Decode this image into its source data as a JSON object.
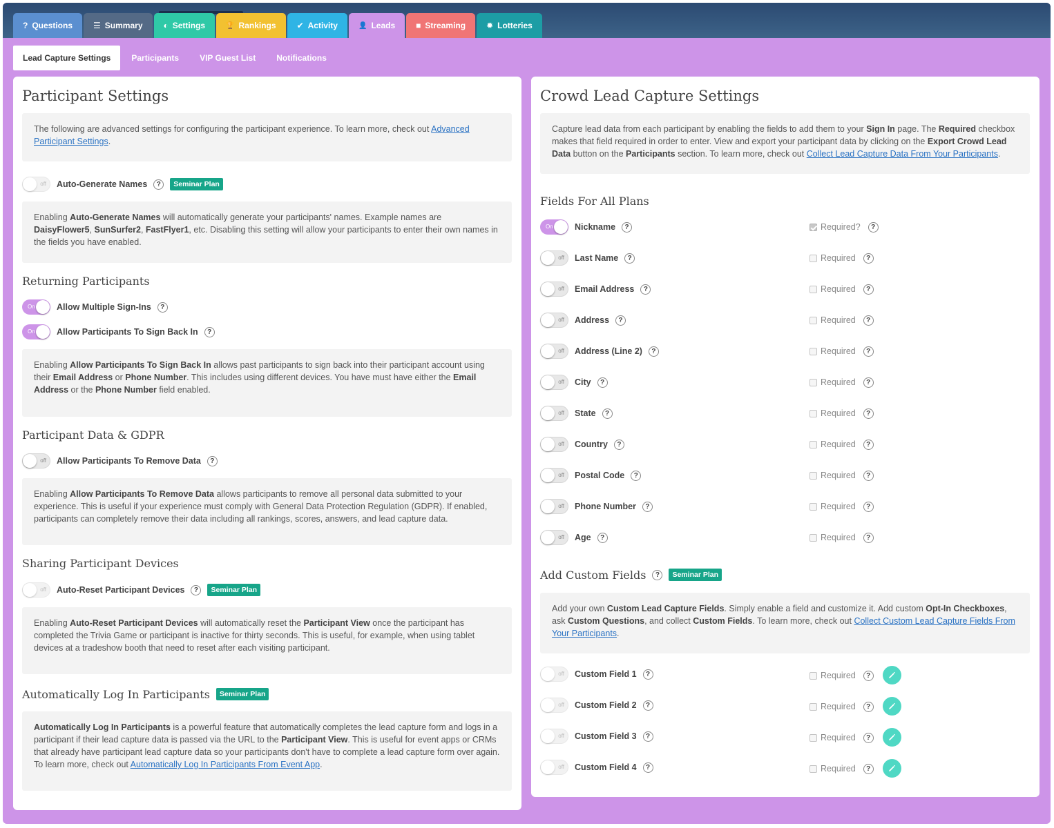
{
  "nav": {
    "tabs": [
      {
        "label": "Questions",
        "icon": "question-icon",
        "glyph": "?",
        "color": "#5b8fd0"
      },
      {
        "label": "Summary",
        "icon": "list-icon",
        "glyph": "☰",
        "color": "#546a86"
      },
      {
        "label": "Settings",
        "icon": "toggle-icon",
        "glyph": "◐",
        "color": "#2fc9a7"
      },
      {
        "label": "Rankings",
        "icon": "trophy-icon",
        "glyph": "🏆",
        "color": "#f2c131"
      },
      {
        "label": "Activity",
        "icon": "check-circle-icon",
        "glyph": "✔",
        "color": "#2fb4e5"
      },
      {
        "label": "Leads",
        "icon": "user-icon",
        "glyph": "👤",
        "color": "#cd94e8"
      },
      {
        "label": "Streaming",
        "icon": "video-icon",
        "glyph": "■",
        "color": "#f07575"
      },
      {
        "label": "Lotteries",
        "icon": "gear-icon",
        "glyph": "✹",
        "color": "#1d9da5"
      }
    ]
  },
  "subnav": {
    "tabs": [
      "Lead Capture Settings",
      "Participants",
      "VIP Guest List",
      "Notifications"
    ]
  },
  "toggle_text": {
    "on": "On",
    "off": "off"
  },
  "badge_text": "Seminar Plan",
  "help_glyph": "?",
  "left": {
    "title": "Participant Settings",
    "intro": {
      "text": "The following are advanced settings for configuring the participant experience. To learn more, check out ",
      "link": "Advanced Participant Settings",
      "end": "."
    },
    "auto_generate": {
      "label": "Auto-Generate Names",
      "desc": {
        "p1": "Enabling ",
        "b1": "Auto-Generate Names",
        "p2": " will automatically generate your participants' names. Example names are ",
        "b2": "DaisyFlower5",
        "p3": ", ",
        "b3": "SunSurfer2",
        "p4": ", ",
        "b4": "FastFlyer1",
        "p5": ", etc. Disabling this setting will allow your participants to enter their own names in the fields you have enabled."
      }
    },
    "returning": {
      "heading": "Returning Participants",
      "multiple_label": "Allow Multiple Sign-Ins",
      "signback_label": "Allow Participants To Sign Back In",
      "desc": {
        "p1": "Enabling ",
        "b1": "Allow Participants To Sign Back In",
        "p2": " allows past participants to sign back into their participant account using their ",
        "b2": "Email Address",
        "p3": " or ",
        "b3": "Phone Number",
        "p4": ". This includes using different devices. You have must have either the ",
        "b4": "Email Address",
        "p5": " or the ",
        "b5": "Phone Number",
        "p6": " field enabled."
      }
    },
    "gdpr": {
      "heading": "Participant Data & GDPR",
      "label": "Allow Participants To Remove Data",
      "desc": {
        "p1": "Enabling ",
        "b1": "Allow Participants To Remove Data",
        "p2": " allows participants to remove all personal data submitted to your experience. This is useful if your experience must comply with General Data Protection Regulation (GDPR). If enabled, participants can completely remove their data including all rankings, scores, answers, and lead capture data."
      }
    },
    "sharing": {
      "heading": "Sharing Participant Devices",
      "label": "Auto-Reset Participant Devices",
      "desc": {
        "p1": "Enabling ",
        "b1": "Auto-Reset Participant Devices",
        "p2": " will automatically reset the ",
        "b2": "Participant View",
        "p3": " once the participant has completed the Trivia Game or participant is inactive for thirty seconds. This is useful, for example, when using tablet devices at a tradeshow booth that need to reset after each visiting participant."
      }
    },
    "autologin": {
      "heading": "Automatically Log In Participants",
      "desc": {
        "b1": "Automatically Log In Participants",
        "p1": " is a powerful feature that automatically completes the lead capture form and logs in a participant if their lead capture data is passed via the URL to the ",
        "b2": "Participant View",
        "p2": ". This is useful for event apps or CRMs that already have participant lead capture data so your participants don't have to complete a lead capture form over again. To learn more, check out ",
        "link": "Automatically Log In Participants From Event App",
        "end": "."
      }
    }
  },
  "right": {
    "title": "Crowd Lead Capture Settings",
    "intro": {
      "p1": "Capture lead data from each participant by enabling the fields to add them to your ",
      "b1": "Sign In",
      "p2": " page. The ",
      "b2": "Required",
      "p3": " checkbox makes that field required in order to enter. View and export your participant data by clicking on the ",
      "b3": "Export Crowd Lead Data",
      "p4": " button on the ",
      "b4": "Participants",
      "p5": " section. To learn more, check out ",
      "link": "Collect Lead Capture Data From Your Participants",
      "end": "."
    },
    "fields_heading": "Fields For All Plans",
    "fields": [
      {
        "label": "Nickname",
        "on": true,
        "required_label": "Required?",
        "required": true
      },
      {
        "label": "Last Name",
        "on": false,
        "required_label": "Required",
        "required": false
      },
      {
        "label": "Email Address",
        "on": false,
        "required_label": "Required",
        "required": false
      },
      {
        "label": "Address",
        "on": false,
        "required_label": "Required",
        "required": false
      },
      {
        "label": "Address (Line 2)",
        "on": false,
        "required_label": "Required",
        "required": false
      },
      {
        "label": "City",
        "on": false,
        "required_label": "Required",
        "required": false
      },
      {
        "label": "State",
        "on": false,
        "required_label": "Required",
        "required": false
      },
      {
        "label": "Country",
        "on": false,
        "required_label": "Required",
        "required": false
      },
      {
        "label": "Postal Code",
        "on": false,
        "required_label": "Required",
        "required": false
      },
      {
        "label": "Phone Number",
        "on": false,
        "required_label": "Required",
        "required": false
      },
      {
        "label": "Age",
        "on": false,
        "required_label": "Required",
        "required": false
      }
    ],
    "custom_heading": "Add Custom Fields",
    "custom_intro": {
      "p1": "Add your own ",
      "b1": "Custom Lead Capture Fields",
      "p2": ". Simply enable a field and customize it. Add custom ",
      "b2": "Opt-In Checkboxes",
      "p3": ", ask ",
      "b3": "Custom Questions",
      "p4": ", and collect ",
      "b4": "Custom Fields",
      "p5": ". To learn more, check out ",
      "link": "Collect Custom Lead Capture Fields From Your Participants",
      "end": "."
    },
    "custom_fields": [
      {
        "label": "Custom Field 1",
        "required_label": "Required"
      },
      {
        "label": "Custom Field 2",
        "required_label": "Required"
      },
      {
        "label": "Custom Field 3",
        "required_label": "Required"
      },
      {
        "label": "Custom Field 4",
        "required_label": "Required"
      }
    ]
  }
}
